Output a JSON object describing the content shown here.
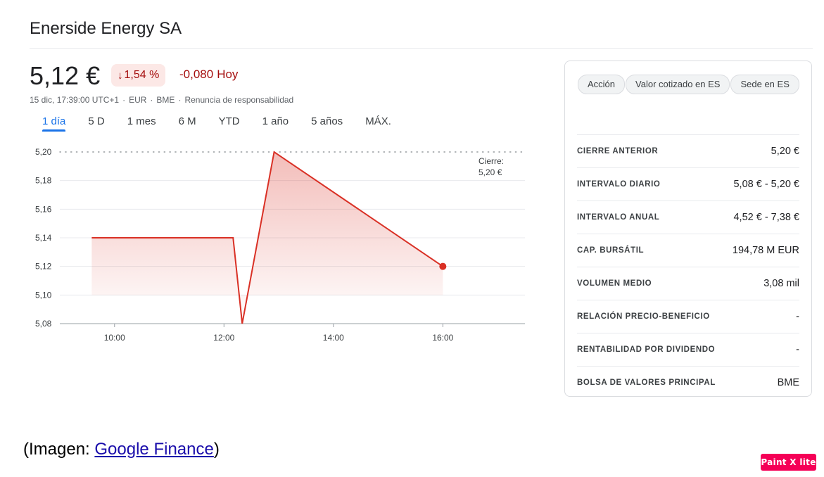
{
  "header": {
    "title": "Enerside Energy SA"
  },
  "quote": {
    "price": "5,12 €",
    "change_pct": "1,54 %",
    "change_abs": "-0,080",
    "change_period": "Hoy",
    "timestamp": "15 dic, 17:39:00 UTC+1",
    "currency": "EUR",
    "exchange": "BME",
    "disclaimer": "Renuncia de responsabilidad",
    "down_color": "#d93025"
  },
  "ranges": [
    "1 día",
    "5 D",
    "1 mes",
    "6 M",
    "YTD",
    "1 año",
    "5 años",
    "MÁX."
  ],
  "active_range": "1 día",
  "chart_data": {
    "type": "line",
    "x": [
      "09:35",
      "12:10",
      "12:20",
      "12:55",
      "16:00"
    ],
    "series": [
      {
        "values": [
          5.14,
          5.14,
          5.08,
          5.2,
          5.12
        ]
      }
    ],
    "xticks": [
      "10:00",
      "12:00",
      "14:00",
      "16:00"
    ],
    "yticks": [
      "5,20",
      "5,18",
      "5,16",
      "5,14",
      "5,12",
      "5,10",
      "5,08"
    ],
    "ylim": [
      5.08,
      5.2
    ],
    "xlim": [
      "09:00",
      "17:30"
    ],
    "previous_close": 5.2,
    "previous_close_label": "Cierre:",
    "previous_close_value": "5,20 €",
    "grid": true,
    "line_color": "#d93025"
  },
  "chips": [
    "Acción",
    "Valor cotizado en ES",
    "Sede en ES"
  ],
  "stats": [
    {
      "label": "CIERRE ANTERIOR",
      "value": "5,20 €"
    },
    {
      "label": "INTERVALO DIARIO",
      "value": "5,08 € - 5,20 €"
    },
    {
      "label": "INTERVALO ANUAL",
      "value": "4,52 € - 7,38 €"
    },
    {
      "label": "CAP. BURSÁTIL",
      "value": "194,78 M EUR"
    },
    {
      "label": "VOLUMEN MEDIO",
      "value": "3,08 mil"
    },
    {
      "label": "RELACIÓN PRECIO-BENEFICIO",
      "value": "-"
    },
    {
      "label": "RENTABILIDAD POR DIVIDENDO",
      "value": "-"
    },
    {
      "label": "BOLSA DE VALORES PRINCIPAL",
      "value": "BME"
    }
  ],
  "caption": {
    "prefix": "(Imagen: ",
    "link": "Google Finance",
    "suffix": ")"
  },
  "watermark": "Paint X lite"
}
